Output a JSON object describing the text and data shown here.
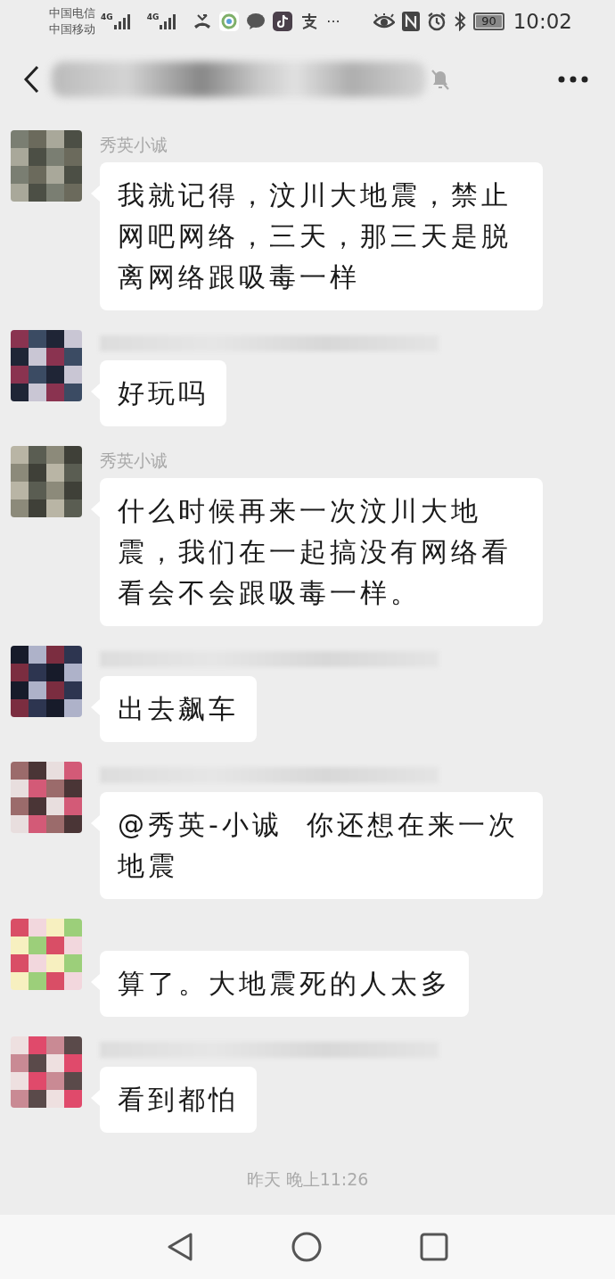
{
  "status_bar": {
    "carriers": [
      "中国电信",
      "中国移动"
    ],
    "network_labels": [
      "4G",
      "4G"
    ],
    "more": "···",
    "battery": "90",
    "time": "10:02"
  },
  "header": {
    "title_redacted": true,
    "muted": true
  },
  "messages": [
    {
      "sender": "秀英小诚",
      "sender_redacted": false,
      "text": "我就记得，汶川大地震，禁止网吧网络，三天，那三天是脱离网络跟吸毒一样"
    },
    {
      "sender_redacted": true,
      "text": "好玩吗"
    },
    {
      "sender": "秀英小诚",
      "sender_redacted": false,
      "text": "什么时候再来一次汶川大地震，我们在一起搞没有网络看看会不会跟吸毒一样。"
    },
    {
      "sender_redacted": true,
      "text": "出去飙车"
    },
    {
      "sender_redacted": true,
      "text": "@秀英-小诚  你还想在来一次地震"
    },
    {
      "sender_redacted": false,
      "text": "算了。大地震死的人太多"
    },
    {
      "sender_redacted": true,
      "text": "看到都怕"
    }
  ],
  "timestamp": "昨天 晚上11:26"
}
